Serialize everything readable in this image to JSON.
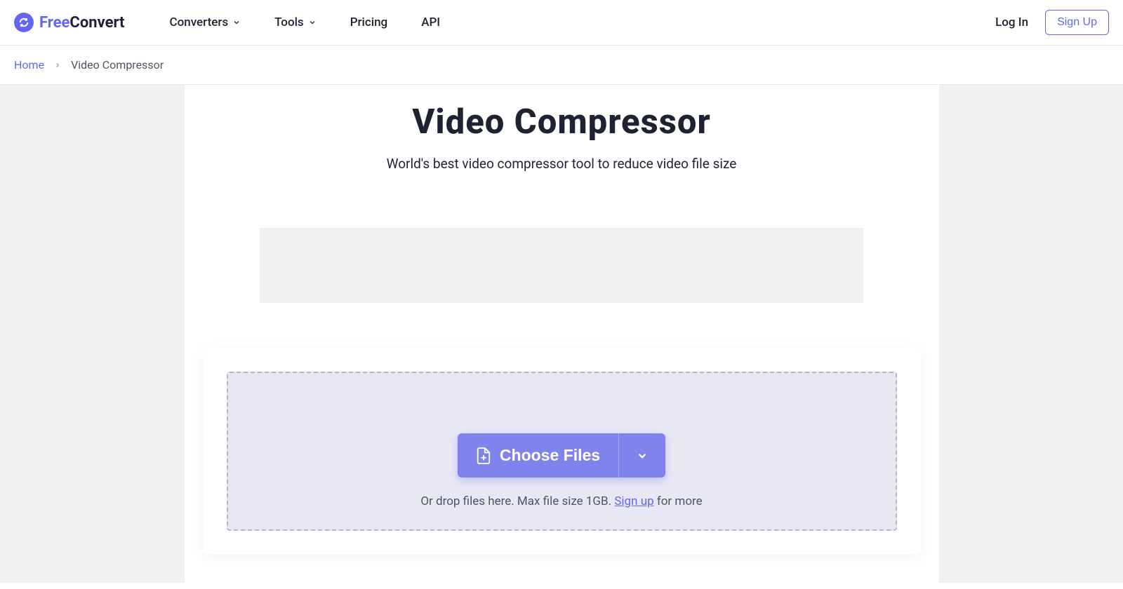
{
  "header": {
    "logo": {
      "free": "Free",
      "convert": "Convert"
    },
    "nav": {
      "converters": "Converters",
      "tools": "Tools",
      "pricing": "Pricing",
      "api": "API"
    },
    "login": "Log In",
    "signup": "Sign Up"
  },
  "breadcrumb": {
    "home": "Home",
    "current": "Video Compressor"
  },
  "main": {
    "title": "Video Compressor",
    "subtitle": "World's best video compressor tool to reduce video file size",
    "choose_files": "Choose Files",
    "drop_prefix": "Or drop files here. Max file size 1GB. ",
    "signup_link": "Sign up",
    "drop_suffix": " for more"
  }
}
